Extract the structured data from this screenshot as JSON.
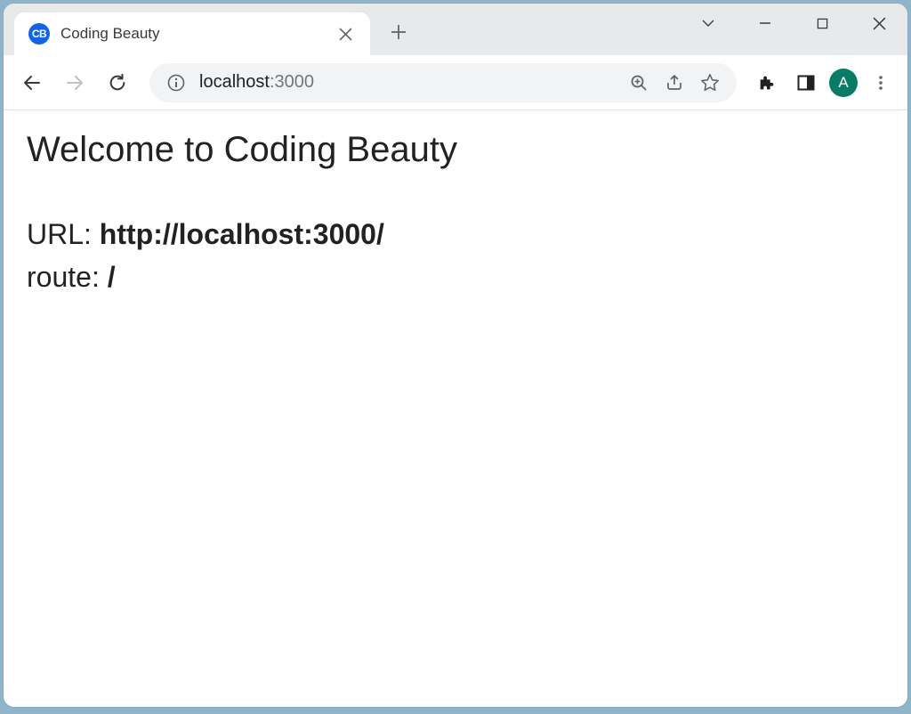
{
  "tab": {
    "favicon_text": "CB",
    "title": "Coding Beauty"
  },
  "address": {
    "host": "localhost",
    "port": ":3000"
  },
  "profile": {
    "initial": "A"
  },
  "page": {
    "heading": "Welcome to Coding Beauty",
    "url_label": "URL: ",
    "url_value": "http://localhost:3000/",
    "route_label": "route: ",
    "route_value": "/"
  }
}
